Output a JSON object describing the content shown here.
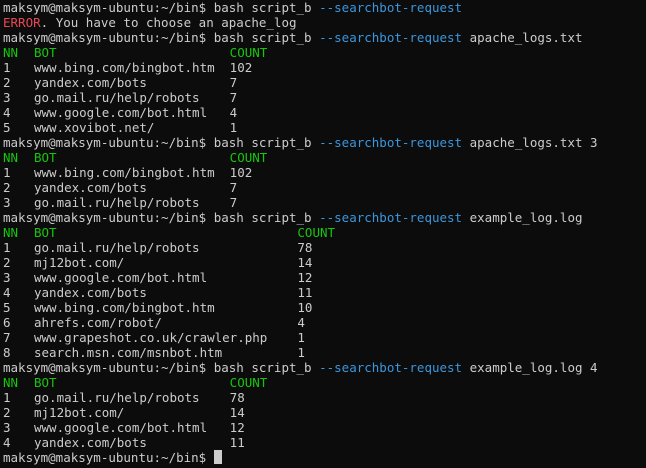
{
  "terminal": {
    "prompt": "maksym@maksym-ubuntu:~/bin$",
    "cmd_prefix": "bash script_b",
    "option": "--searchbot-request",
    "header": {
      "nn": "NN",
      "bot": "BOT",
      "count": "COUNT"
    },
    "commands": [
      {
        "args": "",
        "error": {
          "word": "ERROR",
          "rest": ". You have to choose an apache_log"
        },
        "rows": []
      },
      {
        "args": "apache_logs.txt",
        "rows": [
          {
            "nn": "1",
            "bot": "www.bing.com/bingbot.htm",
            "count": "102"
          },
          {
            "nn": "2",
            "bot": "yandex.com/bots",
            "count": "7"
          },
          {
            "nn": "3",
            "bot": "go.mail.ru/help/robots",
            "count": "7"
          },
          {
            "nn": "4",
            "bot": "www.google.com/bot.html",
            "count": "4"
          },
          {
            "nn": "5",
            "bot": "www.xovibot.net/",
            "count": "1"
          }
        ]
      },
      {
        "args": "apache_logs.txt 3",
        "rows": [
          {
            "nn": "1",
            "bot": "www.bing.com/bingbot.htm",
            "count": "102"
          },
          {
            "nn": "2",
            "bot": "yandex.com/bots",
            "count": "7"
          },
          {
            "nn": "3",
            "bot": "go.mail.ru/help/robots",
            "count": "7"
          }
        ]
      },
      {
        "args": "example_log.log",
        "rows": [
          {
            "nn": "1",
            "bot": "go.mail.ru/help/robots",
            "count": "78"
          },
          {
            "nn": "2",
            "bot": "mj12bot.com/",
            "count": "14"
          },
          {
            "nn": "3",
            "bot": "www.google.com/bot.html",
            "count": "12"
          },
          {
            "nn": "4",
            "bot": "yandex.com/bots",
            "count": "11"
          },
          {
            "nn": "5",
            "bot": "www.bing.com/bingbot.htm",
            "count": "10"
          },
          {
            "nn": "6",
            "bot": "ahrefs.com/robot/",
            "count": "4"
          },
          {
            "nn": "7",
            "bot": "www.grapeshot.co.uk/crawler.php",
            "count": "1"
          },
          {
            "nn": "8",
            "bot": "search.msn.com/msnbot.htm",
            "count": "1"
          }
        ]
      },
      {
        "args": "example_log.log 4",
        "rows": [
          {
            "nn": "1",
            "bot": "go.mail.ru/help/robots",
            "count": "78"
          },
          {
            "nn": "2",
            "bot": "mj12bot.com/",
            "count": "14"
          },
          {
            "nn": "3",
            "bot": "www.google.com/bot.html",
            "count": "12"
          },
          {
            "nn": "4",
            "bot": "yandex.com/bots",
            "count": "11"
          }
        ]
      }
    ]
  },
  "colors": {
    "background": "#0c0c0c",
    "text": "#cccccc",
    "error": "#e74856",
    "option": "#3a96dd",
    "header": "#16c60c"
  }
}
